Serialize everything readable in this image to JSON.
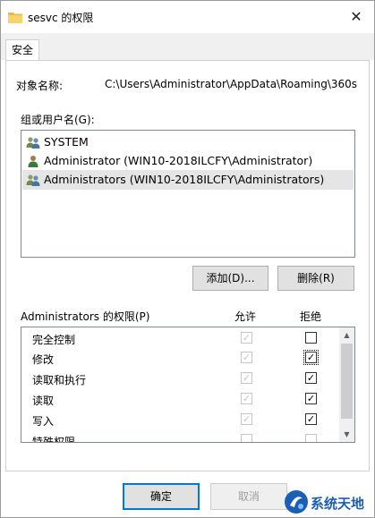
{
  "window": {
    "title": "sesvc 的权限",
    "close_glyph": "✕"
  },
  "tabs": [
    {
      "label": "安全"
    }
  ],
  "object": {
    "label": "对象名称:",
    "value": "C:\\Users\\Administrator\\AppData\\Roaming\\360s"
  },
  "groups": {
    "label": "组或用户名(G):",
    "items": [
      {
        "label": "SYSTEM",
        "icon": "group-users-icon"
      },
      {
        "label": "Administrator (WIN10-2018ILCFY\\Administrator)",
        "icon": "user-icon"
      },
      {
        "label": "Administrators (WIN10-2018ILCFY\\Administrators)",
        "icon": "group-users-icon",
        "selected": true
      }
    ],
    "add_label": "添加(D)...",
    "remove_label": "删除(R)"
  },
  "permissions": {
    "title": "Administrators 的权限(P)",
    "allow_header": "允许",
    "deny_header": "拒绝",
    "rows": [
      {
        "name": "完全控制",
        "allow": true,
        "deny": false
      },
      {
        "name": "修改",
        "allow": true,
        "deny": true
      },
      {
        "name": "读取和执行",
        "allow": true,
        "deny": true
      },
      {
        "name": "读取",
        "allow": true,
        "deny": true
      },
      {
        "name": "写入",
        "allow": true,
        "deny": true
      },
      {
        "name": "特殊权限",
        "allow": false,
        "deny": false
      }
    ]
  },
  "buttons": {
    "ok": "确定",
    "cancel": "取消"
  },
  "watermark": {
    "text": "系统天地"
  },
  "colors": {
    "accent": "#0078d7",
    "watermark": "#1a5fb4"
  }
}
